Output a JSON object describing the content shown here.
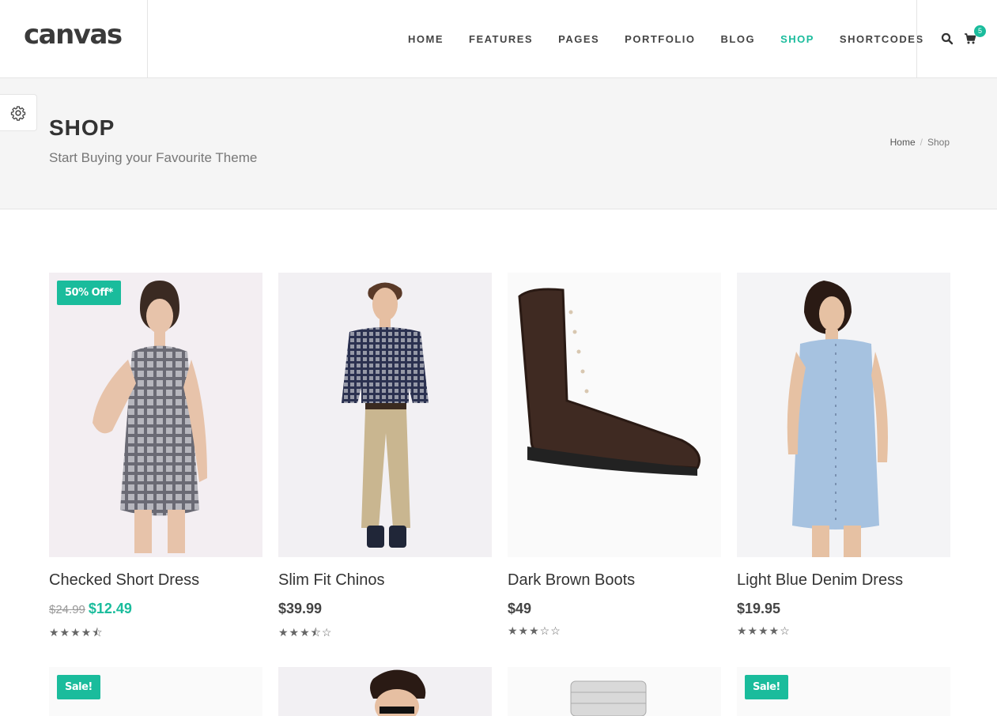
{
  "header": {
    "logo": "canvas",
    "nav": [
      "HOME",
      "FEATURES",
      "PAGES",
      "PORTFOLIO",
      "BLOG",
      "SHOP",
      "SHORTCODES"
    ],
    "active_nav": "SHOP",
    "cart_count": "5"
  },
  "page": {
    "title": "SHOP",
    "subtitle": "Start Buying your Favourite Theme",
    "breadcrumb_home": "Home",
    "breadcrumb_sep": "/",
    "breadcrumb_current": "Shop"
  },
  "products": [
    {
      "title": "Checked Short Dress",
      "old_price": "$24.99",
      "price": "$12.49",
      "stars": "★★★★⯪",
      "badge": "50% Off*",
      "rating": 4.5
    },
    {
      "title": "Slim Fit Chinos",
      "old_price": "",
      "price": "$39.99",
      "stars": "★★★⯪☆",
      "badge": "",
      "rating": 3.5
    },
    {
      "title": "Dark Brown Boots",
      "old_price": "",
      "price": "$49",
      "stars": "★★★☆☆",
      "badge": "",
      "rating": 3
    },
    {
      "title": "Light Blue Denim Dress",
      "old_price": "",
      "price": "$19.95",
      "stars": "★★★★☆",
      "badge": "",
      "rating": 4
    }
  ],
  "row2_badges": [
    "Sale!",
    "",
    "",
    "Sale!"
  ],
  "colors": {
    "accent": "#1abc9c",
    "text": "#333333",
    "bg_title": "#f5f5f5"
  }
}
